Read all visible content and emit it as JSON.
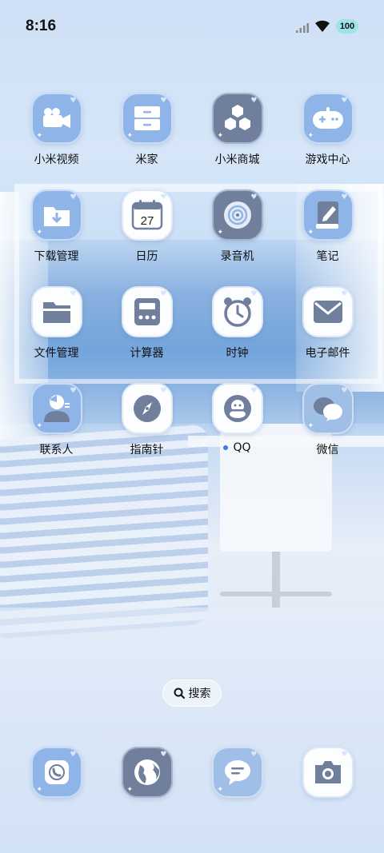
{
  "status_bar": {
    "time": "8:16",
    "battery": "100"
  },
  "apps": [
    {
      "label": "小米视频",
      "icon": "video-camera-icon",
      "style": "tile-blue"
    },
    {
      "label": "米家",
      "icon": "mijia-cabinet-icon",
      "style": "tile-blue"
    },
    {
      "label": "小米商城",
      "icon": "hexagon-store-icon",
      "style": "tile-slate"
    },
    {
      "label": "游戏中心",
      "icon": "gamepad-icon",
      "style": "tile-blue"
    },
    {
      "label": "下载管理",
      "icon": "download-folder-icon",
      "style": "tile-blue"
    },
    {
      "label": "日历",
      "icon": "calendar-icon",
      "style": "tile-white",
      "badge": "27"
    },
    {
      "label": "录音机",
      "icon": "recorder-icon",
      "style": "tile-slate"
    },
    {
      "label": "笔记",
      "icon": "notes-icon",
      "style": "tile-blue"
    },
    {
      "label": "文件管理",
      "icon": "folder-icon",
      "style": "tile-white"
    },
    {
      "label": "计算器",
      "icon": "calculator-icon",
      "style": "tile-white"
    },
    {
      "label": "时钟",
      "icon": "alarm-clock-icon",
      "style": "tile-white"
    },
    {
      "label": "电子邮件",
      "icon": "mail-icon",
      "style": "tile-white"
    },
    {
      "label": "联系人",
      "icon": "contacts-icon",
      "style": "tile-blue"
    },
    {
      "label": "指南针",
      "icon": "compass-icon",
      "style": "tile-white"
    },
    {
      "label": "QQ",
      "icon": "qq-penguin-icon",
      "style": "tile-white",
      "dot": true
    },
    {
      "label": "微信",
      "icon": "wechat-icon",
      "style": "tile-mid"
    }
  ],
  "search": {
    "label": "搜索"
  },
  "dock": [
    {
      "icon": "phone-icon"
    },
    {
      "icon": "browser-globe-icon"
    },
    {
      "icon": "messages-icon"
    },
    {
      "icon": "camera-icon"
    }
  ],
  "colors": {
    "icon_glyph": "#6f7f9c",
    "tile_blue": "#8fb5e8",
    "tile_slate": "#6f7f9c"
  }
}
